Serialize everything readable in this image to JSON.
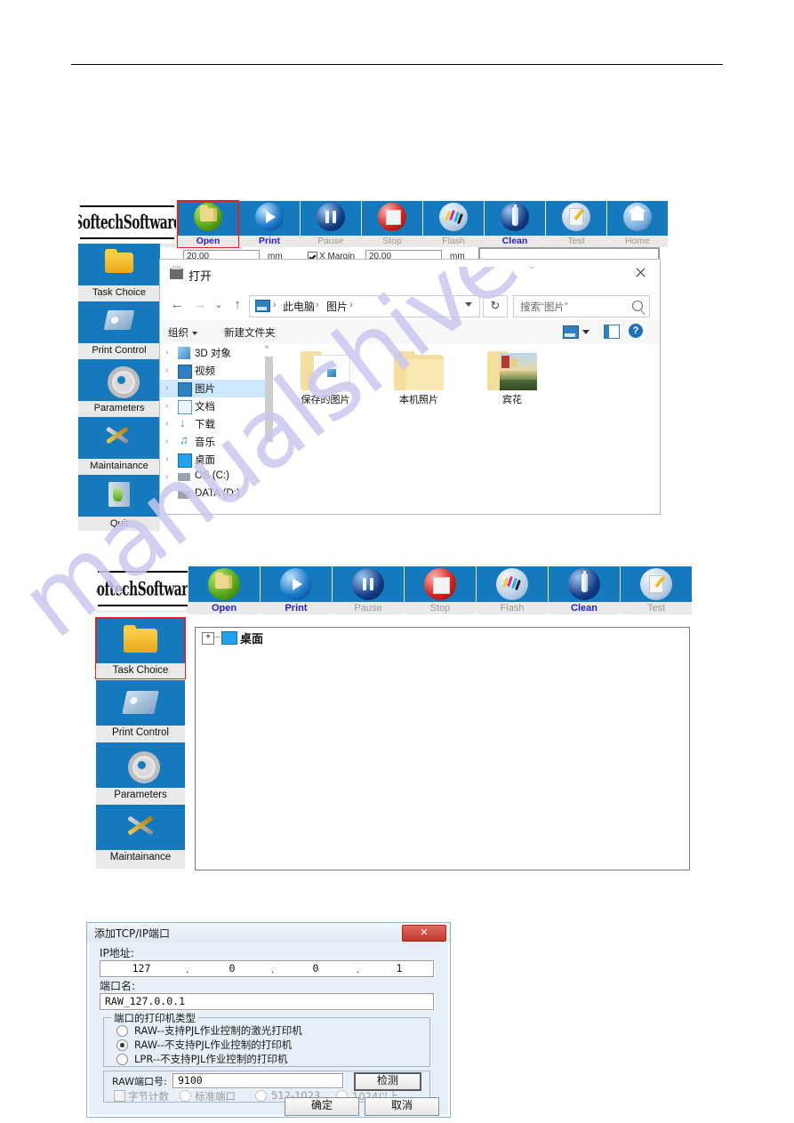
{
  "watermark": {
    "text": "manualshive.com"
  },
  "app": {
    "logo": "SoftechSoftware",
    "toolbar": [
      {
        "label": "Open",
        "icon": "open-folder-icon",
        "active": true,
        "selected": true
      },
      {
        "label": "Print",
        "icon": "play-icon",
        "active": true,
        "selected": false
      },
      {
        "label": "Pause",
        "icon": "pause-icon",
        "active": false,
        "selected": false
      },
      {
        "label": "Stop",
        "icon": "stop-icon",
        "active": false,
        "selected": false
      },
      {
        "label": "Flash",
        "icon": "ink-drops-icon",
        "active": false,
        "selected": false
      },
      {
        "label": "Clean",
        "icon": "ink-bottle-icon",
        "active": true,
        "selected": false
      },
      {
        "label": "Test",
        "icon": "document-pencil-icon",
        "active": false,
        "selected": false
      },
      {
        "label": "Home",
        "icon": "home-icon",
        "active": false,
        "selected": false
      }
    ],
    "sidebar_full": [
      {
        "label": "Task Choice",
        "icon": "folder-icon",
        "selected": false
      },
      {
        "label": "Print Control",
        "icon": "printer-icon",
        "selected": false
      },
      {
        "label": "Parameters",
        "icon": "gear-icon",
        "selected": false
      },
      {
        "label": "Maintainance",
        "icon": "tools-icon",
        "selected": false
      },
      {
        "label": "Quit",
        "icon": "exit-door-icon",
        "selected": false
      }
    ],
    "sidebar_second": [
      {
        "label": "Task Choice",
        "icon": "folder-icon",
        "selected": true
      },
      {
        "label": "Print Control",
        "icon": "printer-icon",
        "selected": false
      },
      {
        "label": "Parameters",
        "icon": "gear-icon",
        "selected": false
      },
      {
        "label": "Maintainance",
        "icon": "tools-icon",
        "selected": false
      }
    ],
    "form_fields": {
      "width_value": "20.00",
      "width_unit": "mm",
      "margin_label": "X Margin",
      "margin_value": "20.00",
      "margin_unit": "mm"
    },
    "tree_root": {
      "label": "桌面",
      "expander": "+"
    }
  },
  "open_dialog": {
    "title": "打开",
    "title_icon": "printer-icon",
    "close_icon": "close-icon",
    "nav": {
      "back": "←",
      "forward": "→",
      "recent": "⌄",
      "up": "↑",
      "refresh_icon": "refresh-icon",
      "crumbs": [
        "此电脑",
        "图片"
      ],
      "crumb_sep": "›",
      "search_placeholder": "搜索“图片”",
      "search_icon": "search-icon"
    },
    "commandbar": {
      "organize": "组织",
      "new_folder": "新建文件夹",
      "view_icon": "view-icon",
      "pane_icon": "preview-pane-icon",
      "help_icon": "help-icon",
      "help_label": "?"
    },
    "tree": [
      {
        "label": "3D 对象",
        "icon": "3d-objects-icon",
        "selected": false
      },
      {
        "label": "视频",
        "icon": "videos-icon",
        "selected": false
      },
      {
        "label": "图片",
        "icon": "pictures-icon",
        "selected": true
      },
      {
        "label": "文档",
        "icon": "documents-icon",
        "selected": false
      },
      {
        "label": "下载",
        "icon": "downloads-icon",
        "selected": false
      },
      {
        "label": "音乐",
        "icon": "music-icon",
        "selected": false
      },
      {
        "label": "桌面",
        "icon": "desktop-icon",
        "selected": false
      },
      {
        "label": "OS (C:)",
        "icon": "drive-icon",
        "selected": false
      },
      {
        "label": "DATA (D:)",
        "icon": "drive-icon",
        "selected": false
      }
    ],
    "files": [
      {
        "name": "保存的图片",
        "type": "folder-with-image"
      },
      {
        "name": "本机照片",
        "type": "folder"
      },
      {
        "name": "宾花",
        "type": "folder-with-thumbnail"
      }
    ]
  },
  "tcp_dialog": {
    "title": "添加TCP/IP端口",
    "close_label": "✕",
    "ip_label": "IP地址:",
    "ip_octets": [
      "127",
      "0",
      "0",
      "1"
    ],
    "ip_dot": ".",
    "port_name_label": "端口名:",
    "port_name_value": "RAW_127.0.0.1",
    "group_label": "端口的打印机类型",
    "radios": [
      {
        "text": "RAW--支持PJL作业控制的激光打印机",
        "checked": false
      },
      {
        "text": "RAW--不支持PJL作业控制的打印机",
        "checked": true
      },
      {
        "text": "LPR--不支持PJL作业控制的打印机",
        "checked": false
      }
    ],
    "raw_port_label": "RAW端口号:",
    "raw_port_value": "9100",
    "detect_button": "检测",
    "byte_count_label": "字节计数",
    "standard_port_label": "标准端口",
    "range_512": "512-1023",
    "range_1024": "1024以上",
    "ok_button": "确定",
    "cancel_button": "取消"
  }
}
